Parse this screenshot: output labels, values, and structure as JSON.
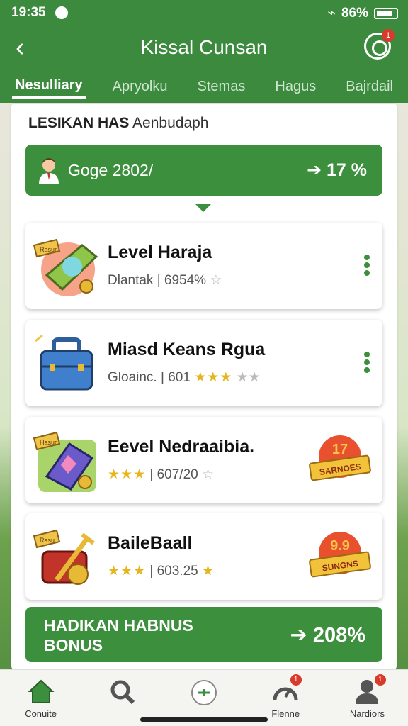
{
  "status": {
    "time": "19:35",
    "battery": "86%"
  },
  "header": {
    "title": "Kissal Cunsan",
    "badge": "1"
  },
  "tabs": [
    "Nesulliary",
    "Apryolku",
    "Stemas",
    "Hagus",
    "Bajrdail"
  ],
  "panel": {
    "heading_bold": "LESIKAN HAS",
    "heading_rest": "Aenbudaph",
    "summary_label": "Goge 2802/",
    "summary_value": "17 %"
  },
  "cards": [
    {
      "name": "Level Haraja",
      "meta_text": "Dlantak | 6954%",
      "stars": "",
      "stars_dim": "☆",
      "tag": "Rasur"
    },
    {
      "name": "Miasd Keans Rgua",
      "meta_text": "Gloainc. | 601",
      "stars": "★★★",
      "stars_dim": "★★",
      "tag": ""
    },
    {
      "name": "Eevel Nedraaibia.",
      "meta_text": "| 607/20",
      "stars": "★★★",
      "stars_dim": "☆",
      "tag": "Hasur",
      "seal_top": "17",
      "seal_label": "SARNOES"
    },
    {
      "name": "BaileBaall",
      "meta_text": "| 603.25",
      "stars": "★★★",
      "stars_dim": "★",
      "tag": "Rasu",
      "seal_top": "9.9",
      "seal_label": "SUNGNS"
    }
  ],
  "bonus": {
    "label": "HADIKAN HABNUS BONUS",
    "value": "208%"
  },
  "nav": [
    {
      "label": "Conuite",
      "icon": "home-icon",
      "badge": ""
    },
    {
      "label": "",
      "icon": "search-icon",
      "badge": ""
    },
    {
      "label": "",
      "icon": "add-icon",
      "badge": ""
    },
    {
      "label": "Flenne",
      "icon": "speedometer-icon",
      "badge": "1"
    },
    {
      "label": "Nardiors",
      "icon": "profile-icon",
      "badge": "1"
    }
  ],
  "colors": {
    "primary": "#3c8f3c",
    "accent_gold": "#e6b51e",
    "badge": "#d93a2b"
  }
}
